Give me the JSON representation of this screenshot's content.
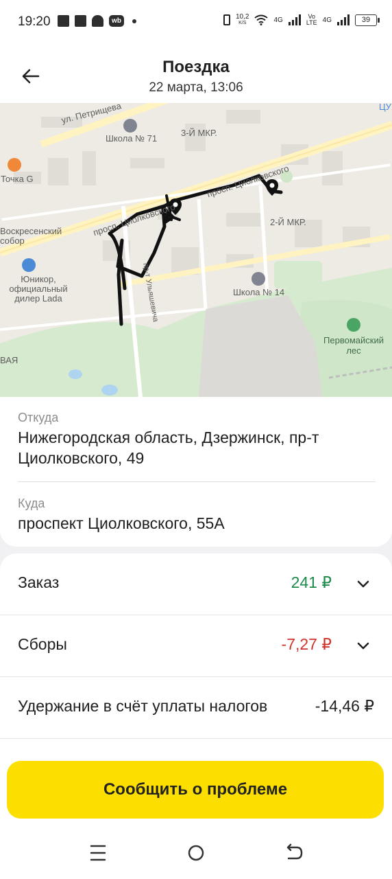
{
  "status_bar": {
    "time": "19:20",
    "speed_value": "10,2",
    "speed_unit": "K/S",
    "net1": "4G",
    "volte_top": "Vo",
    "volte_bottom": "LTE",
    "net2": "4G",
    "battery": "39"
  },
  "header": {
    "title": "Поездка",
    "subtitle": "22 марта, 13:06"
  },
  "map": {
    "labels": {
      "street1": "ул. Петрищева",
      "school71": "Школа № 71",
      "district3": "3-Й МКР.",
      "tochka": "Точка G",
      "avenue1": "просп. Циолковского",
      "avenue2": "просп. Циолковского",
      "church": "Воскресенский собор",
      "district2": "2-Й МКР.",
      "yunikor": "Юникор, официальный дилер Lada",
      "street2": "пр-т Ульяшевича",
      "school14": "Школа № 14",
      "forest": "Первомайский лес",
      "edge_left": "ВАЯ",
      "edge_right": "ЦУ"
    }
  },
  "trip": {
    "from_label": "Откуда",
    "from_value": "Нижегородская область, Дзержинск, пр-т Циолковского, 49",
    "to_label": "Куда",
    "to_value": "проспект Циолковского, 55А"
  },
  "prices": {
    "order_label": "Заказ",
    "order_value": "241 ₽",
    "fees_label": "Сборы",
    "fees_value": "-7,27 ₽",
    "tax_label": "Удержание в счёт уплаты налогов",
    "tax_value": "-14,46 ₽"
  },
  "actions": {
    "report_problem": "Сообщить о проблеме"
  },
  "colors": {
    "positive": "#1d8a4a",
    "negative": "#d0332a",
    "accent": "#fcdf00"
  }
}
